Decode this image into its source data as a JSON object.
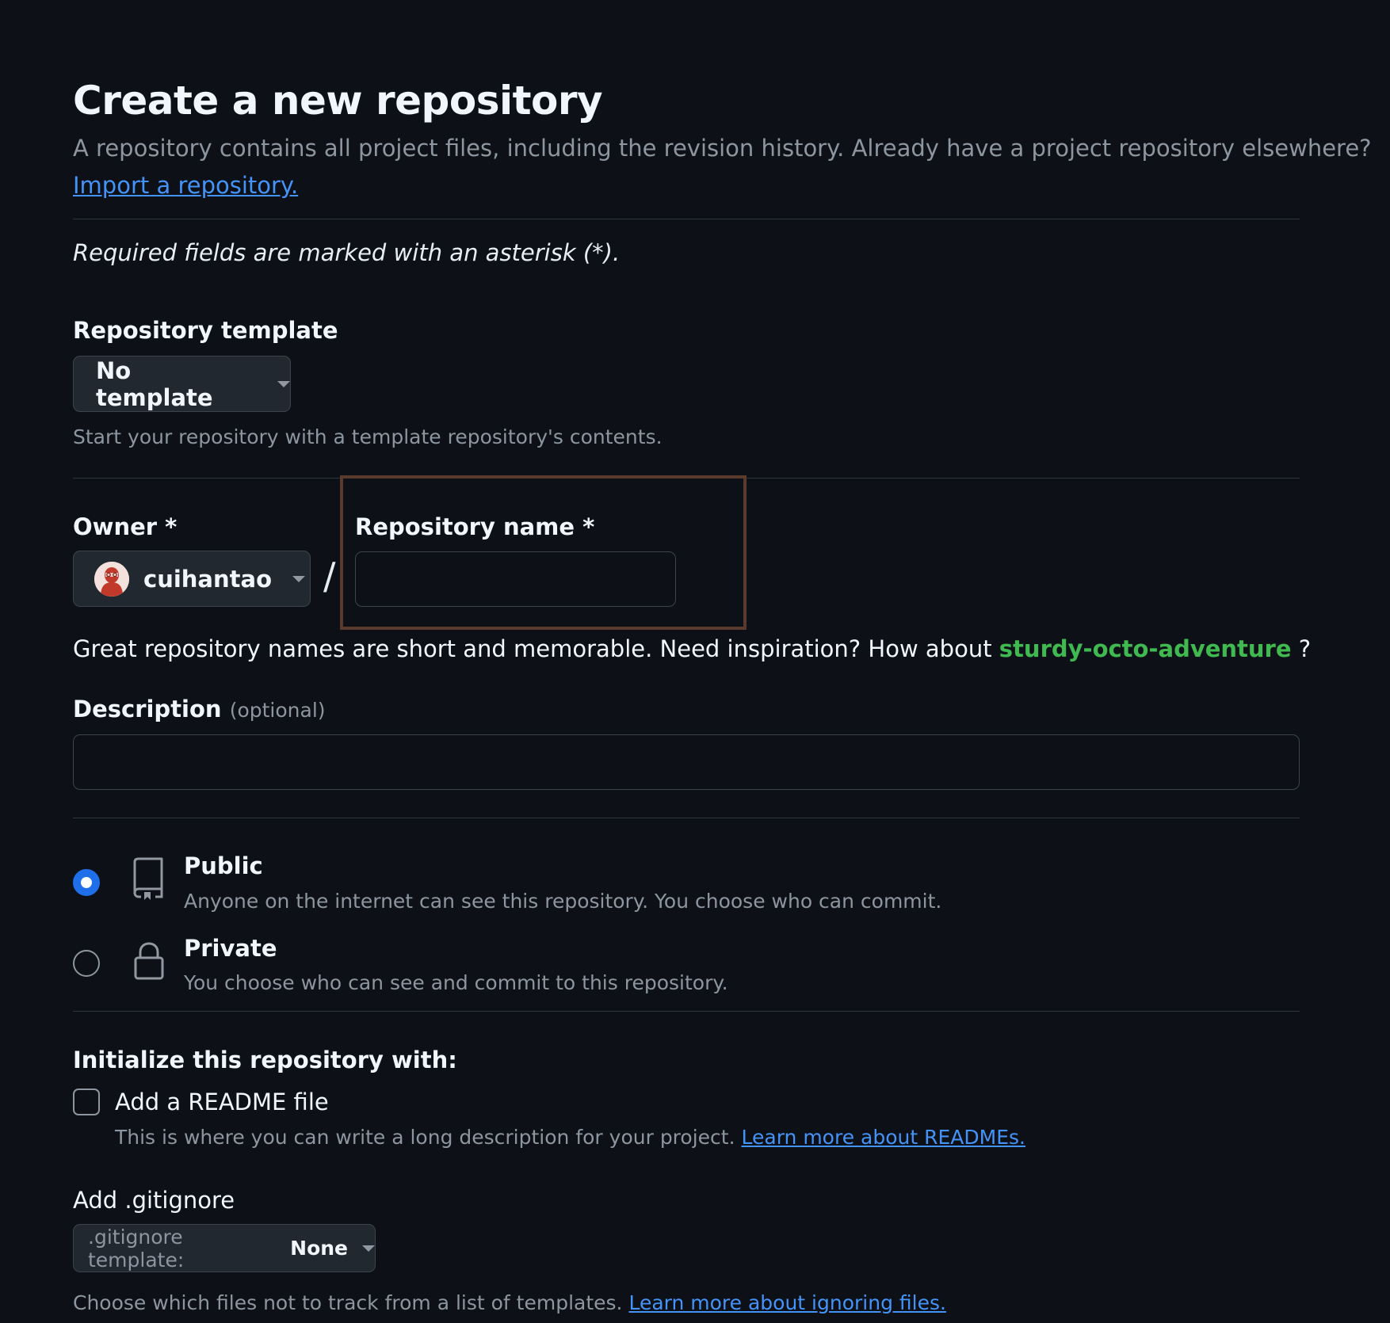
{
  "page": {
    "title": "Create a new repository",
    "subtitle": "A repository contains all project files, including the revision history. Already have a project repository elsewhere?",
    "import_link": "Import a repository.",
    "required_note": "Required fields are marked with an asterisk (*)."
  },
  "template": {
    "label": "Repository template",
    "selected": "No template",
    "help": "Start your repository with a template repository's contents."
  },
  "owner": {
    "label": "Owner *",
    "name": "cuihantao"
  },
  "repo_name": {
    "label": "Repository name *",
    "value": ""
  },
  "separator": "/",
  "suggestion": {
    "prefix": "Great repository names are short and memorable. Need inspiration? How about ",
    "name": "sturdy-octo-adventure",
    "suffix": " ?"
  },
  "description": {
    "label": "Description",
    "optional": "(optional)",
    "value": ""
  },
  "visibility": {
    "public": {
      "title": "Public",
      "desc": "Anyone on the internet can see this repository. You choose who can commit.",
      "selected": true
    },
    "private": {
      "title": "Private",
      "desc": "You choose who can see and commit to this repository.",
      "selected": false
    }
  },
  "initialize": {
    "heading": "Initialize this repository with:",
    "readme_label": "Add a README file",
    "readme_help": "This is where you can write a long description for your project.",
    "readme_link": "Learn more about READMEs.",
    "readme_checked": false
  },
  "gitignore": {
    "label": "Add .gitignore",
    "prefix": ".gitignore template:",
    "value": "None",
    "help": "Choose which files not to track from a list of templates.",
    "link": "Learn more about ignoring files."
  },
  "colors": {
    "background": "#0d1117",
    "accent": "#1f6feb",
    "link": "#4493f8",
    "suggestion": "#3fb950"
  },
  "icons": {
    "template_caret": "caret-down-icon",
    "owner_caret": "caret-down-icon",
    "public": "repo-icon",
    "private": "lock-icon",
    "gitignore_caret": "caret-down-icon"
  }
}
